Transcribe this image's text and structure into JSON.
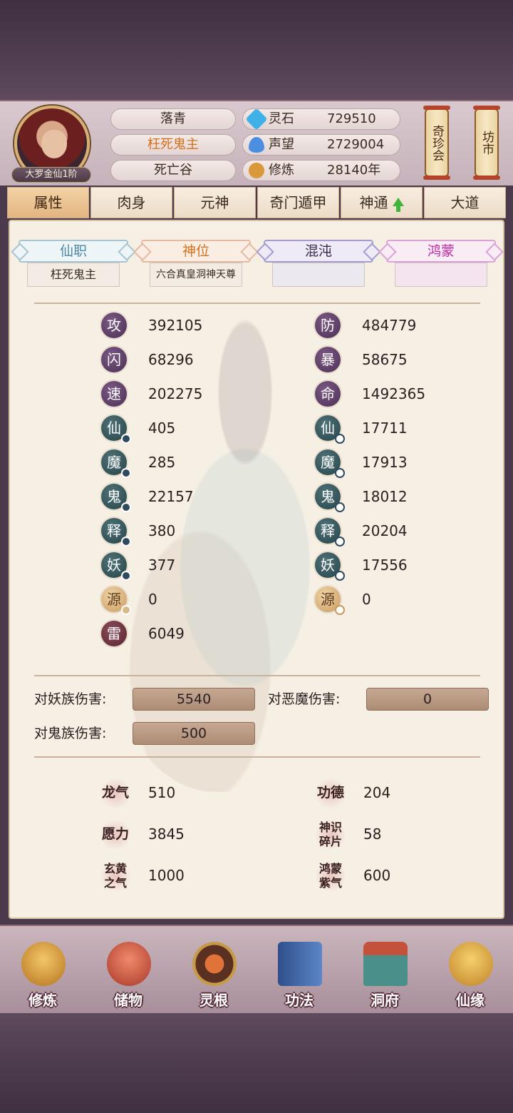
{
  "header": {
    "rank_badge": "大罗金仙1阶",
    "names": [
      "落青",
      "枉死鬼主",
      "死亡谷"
    ],
    "resources": [
      {
        "icon": "spirit-stone-icon",
        "label": "灵石",
        "value": "729510",
        "color": "#3fb0e8"
      },
      {
        "icon": "reputation-icon",
        "label": "声望",
        "value": "2729004",
        "color": "#4b8fe0"
      },
      {
        "icon": "cultivation-icon",
        "label": "修炼",
        "value": "28140年",
        "color": "#d9983a"
      }
    ],
    "side_buttons": [
      "奇珍会",
      "坊市"
    ]
  },
  "tabs": [
    {
      "label": "属性",
      "active": true
    },
    {
      "label": "肉身"
    },
    {
      "label": "元神"
    },
    {
      "label": "奇门遁甲"
    },
    {
      "label": "神通"
    },
    {
      "label": "大道"
    }
  ],
  "rank_cards": [
    {
      "head": "仙职",
      "body": "枉死鬼主"
    },
    {
      "head": "神位",
      "body": "六合真皇洞神天尊"
    },
    {
      "head": "混沌",
      "body": ""
    },
    {
      "head": "鸿蒙",
      "body": ""
    }
  ],
  "stats_left": [
    {
      "icon": "攻",
      "value": "392105"
    },
    {
      "icon": "闪",
      "value": "68296"
    },
    {
      "icon": "速",
      "value": "202275"
    },
    {
      "icon": "仙",
      "value": "405"
    },
    {
      "icon": "魔",
      "value": "285"
    },
    {
      "icon": "鬼",
      "value": "22157"
    },
    {
      "icon": "释",
      "value": "380"
    },
    {
      "icon": "妖",
      "value": "377"
    },
    {
      "icon": "源",
      "value": "0"
    },
    {
      "icon": "雷",
      "value": "6049"
    }
  ],
  "stats_right": [
    {
      "icon": "防",
      "value": "484779"
    },
    {
      "icon": "暴",
      "value": "58675"
    },
    {
      "icon": "命",
      "value": "1492365"
    },
    {
      "icon": "仙",
      "value": "17711"
    },
    {
      "icon": "魔",
      "value": "17913"
    },
    {
      "icon": "鬼",
      "value": "18012"
    },
    {
      "icon": "释",
      "value": "20204"
    },
    {
      "icon": "妖",
      "value": "17556"
    },
    {
      "icon": "源",
      "value": "0"
    }
  ],
  "damage": [
    {
      "label": "对妖族伤害:",
      "value": "5540"
    },
    {
      "label": "对恶魔伤害:",
      "value": "0"
    },
    {
      "label": "对鬼族伤害:",
      "value": "500"
    }
  ],
  "extra_stats": [
    {
      "icon": "龙气",
      "value": "510"
    },
    {
      "icon": "功德",
      "value": "204"
    },
    {
      "icon": "愿力",
      "value": "3845"
    },
    {
      "icon": "神识碎片",
      "value": "58"
    },
    {
      "icon": "玄黄之气",
      "value": "1000"
    },
    {
      "icon": "鸿蒙紫气",
      "value": "600"
    }
  ],
  "bottom_nav": [
    {
      "label": "修炼",
      "color": "#d9a24a"
    },
    {
      "label": "储物",
      "color": "#d9604a"
    },
    {
      "label": "灵根",
      "color": "#b8572c"
    },
    {
      "label": "功法",
      "color": "#3e6bb0"
    },
    {
      "label": "洞府",
      "color": "#4a8f8a"
    },
    {
      "label": "仙缘",
      "color": "#e0a842"
    }
  ]
}
